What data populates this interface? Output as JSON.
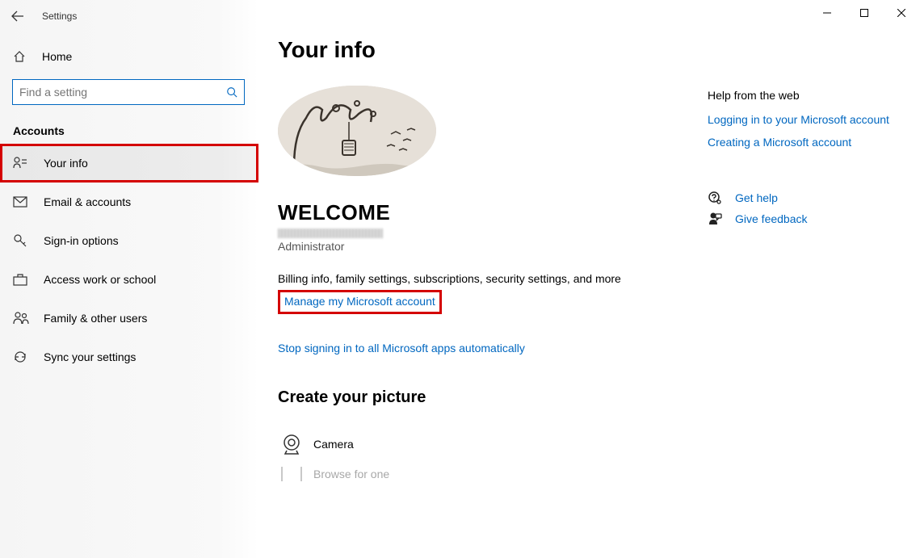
{
  "app_title": "Settings",
  "sidebar": {
    "home": "Home",
    "search_placeholder": "Find a setting",
    "section": "Accounts",
    "items": [
      {
        "label": "Your info"
      },
      {
        "label": "Email & accounts"
      },
      {
        "label": "Sign-in options"
      },
      {
        "label": "Access work or school"
      },
      {
        "label": "Family & other users"
      },
      {
        "label": "Sync your settings"
      }
    ]
  },
  "page": {
    "title": "Your info",
    "welcome": "WELCOME",
    "role": "Administrator",
    "billing_desc": "Billing info, family settings, subscriptions, security settings, and more",
    "manage_link": "Manage my Microsoft account",
    "stop_link": "Stop signing in to all Microsoft apps automatically",
    "create_picture": "Create your picture",
    "camera": "Camera",
    "browse": "Browse for one"
  },
  "help": {
    "header": "Help from the web",
    "links": [
      "Logging in to your Microsoft account",
      "Creating a Microsoft account"
    ],
    "get_help": "Get help",
    "give_feedback": "Give feedback"
  }
}
